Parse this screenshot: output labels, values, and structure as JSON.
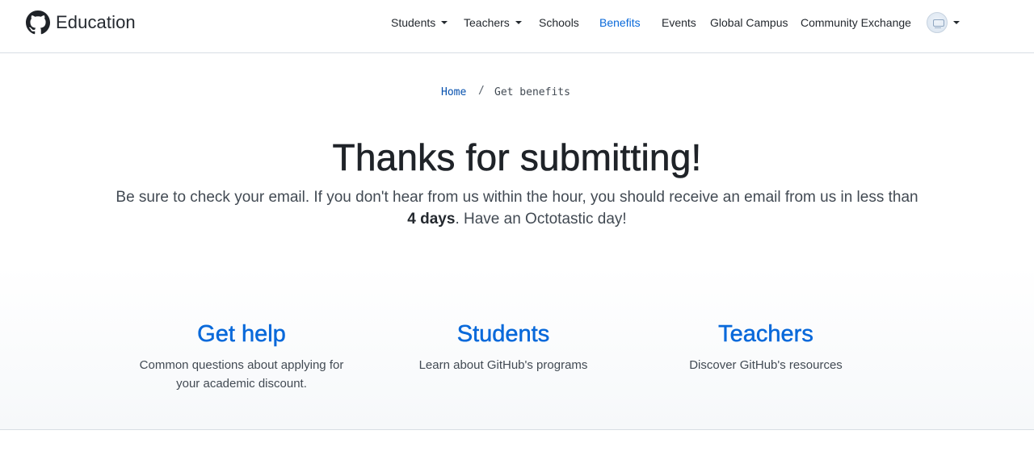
{
  "header": {
    "brand": "Education",
    "nav": [
      {
        "label": "Students",
        "has_caret": true,
        "active": false
      },
      {
        "label": "Teachers",
        "has_caret": true,
        "active": false
      },
      {
        "label": "Schools",
        "has_caret": false,
        "active": false
      },
      {
        "label": "Benefits",
        "has_caret": false,
        "active": true
      },
      {
        "label": "Events",
        "has_caret": false,
        "active": false
      },
      {
        "label": "Global Campus",
        "has_caret": false,
        "active": false
      },
      {
        "label": "Community Exchange",
        "has_caret": false,
        "active": false
      }
    ],
    "icons": {
      "logo": "github-mark-icon",
      "avatar": "user-avatar",
      "avatar_menu": "chevron-down-icon"
    }
  },
  "breadcrumb": {
    "home": "Home",
    "separator": "/",
    "current": "Get benefits"
  },
  "hero": {
    "title": "Thanks for submitting!",
    "text_before": "Be sure to check your email. If you don't hear from us within the hour, you should receive an email from us in less than ",
    "text_bold": "4 days",
    "text_after": ". Have an Octotastic day!"
  },
  "links": {
    "get_help": {
      "title": "Get help",
      "description": "Common questions about applying for your academic discount."
    },
    "students": {
      "title": "Students",
      "description": "Learn about GitHub's programs"
    },
    "teachers": {
      "title": "Teachers",
      "description": "Discover GitHub's resources"
    }
  },
  "colors": {
    "link": "#0969da",
    "text": "#24292f",
    "muted": "#424a53",
    "border": "#d8dee4"
  }
}
